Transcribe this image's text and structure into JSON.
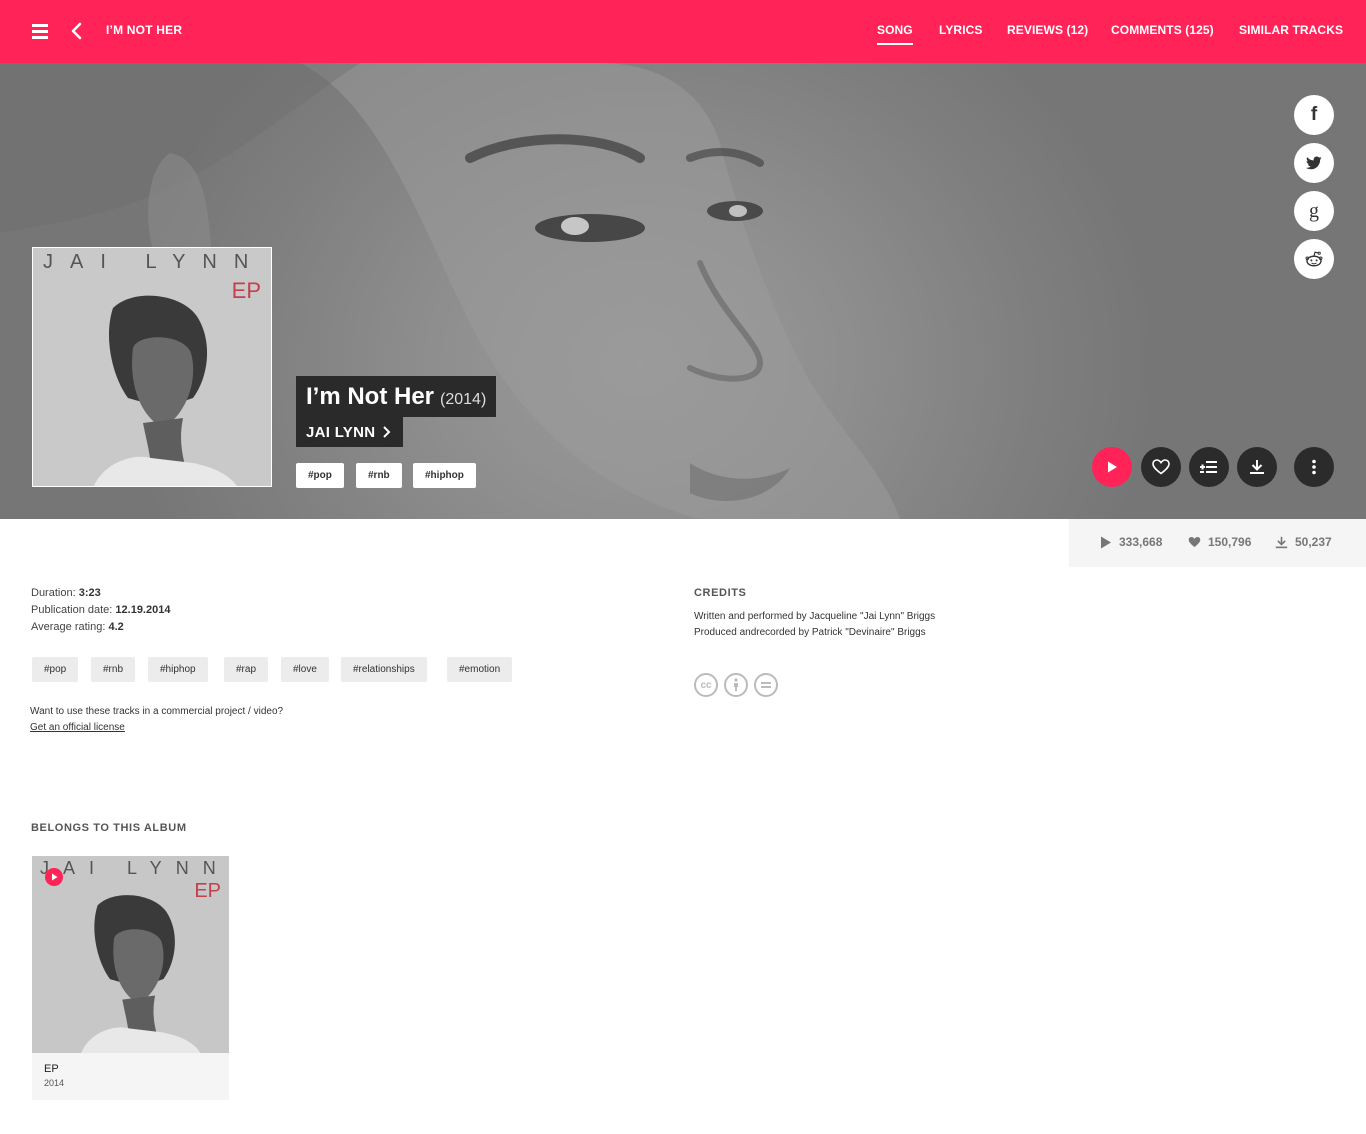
{
  "header": {
    "title": "I’M NOT HER",
    "tabs": [
      {
        "label": "SONG",
        "active": true
      },
      {
        "label": "LYRICS",
        "active": false
      },
      {
        "label": "REVIEWS (12)",
        "active": false
      },
      {
        "label": "COMMENTS (125)",
        "active": false
      },
      {
        "label": "SIMILAR TRACKS",
        "active": false
      }
    ]
  },
  "hero": {
    "cover": {
      "brand_text": "JAI LYNN",
      "edition": "EP"
    },
    "song_title": "I’m Not Her",
    "year": "(2014)",
    "artist": "JAI LYNN",
    "tags": [
      "#pop",
      "#rnb",
      "#hiphop"
    ],
    "share": [
      {
        "network": "facebook",
        "icon": "facebook-icon"
      },
      {
        "network": "twitter",
        "icon": "twitter-icon"
      },
      {
        "network": "google",
        "icon": "google-icon"
      },
      {
        "network": "reddit",
        "icon": "reddit-icon"
      }
    ],
    "actions": [
      "play",
      "like",
      "add-to-playlist",
      "download",
      "more"
    ]
  },
  "stats": {
    "plays": "333,668",
    "likes": "150,796",
    "downloads": "50,237"
  },
  "details": {
    "duration_label": "Duration:",
    "duration": "3:23",
    "pubdate_label": "Publication date:",
    "pubdate": "12.19.2014",
    "rating_label": "Average rating:",
    "rating": "4.2",
    "tags": [
      "#pop",
      "#rnb",
      "#hiphop",
      "#rap",
      "#love",
      "#relationships",
      "#emotion"
    ],
    "license_question": "Want to use these tracks in a commercial project / video?",
    "license_link": "Get an official license"
  },
  "credits": {
    "heading": "CREDITS",
    "lines": [
      "Written and performed by Jacqueline \"Jai Lynn\" Briggs",
      "Produced andrecorded by Patrick \"Devinaire\" Briggs"
    ],
    "license_icons": [
      "cc-icon",
      "by-attribution-icon",
      "no-derivatives-icon"
    ]
  },
  "album": {
    "heading": "BELONGS TO THIS ALBUM",
    "name": "EP",
    "year": "2014",
    "cover": {
      "brand_text": "JAI LYNN",
      "edition": "EP"
    }
  },
  "colors": {
    "accent": "#ff2357",
    "dark": "#2b2b2b",
    "light_bg": "#f5f5f5"
  }
}
